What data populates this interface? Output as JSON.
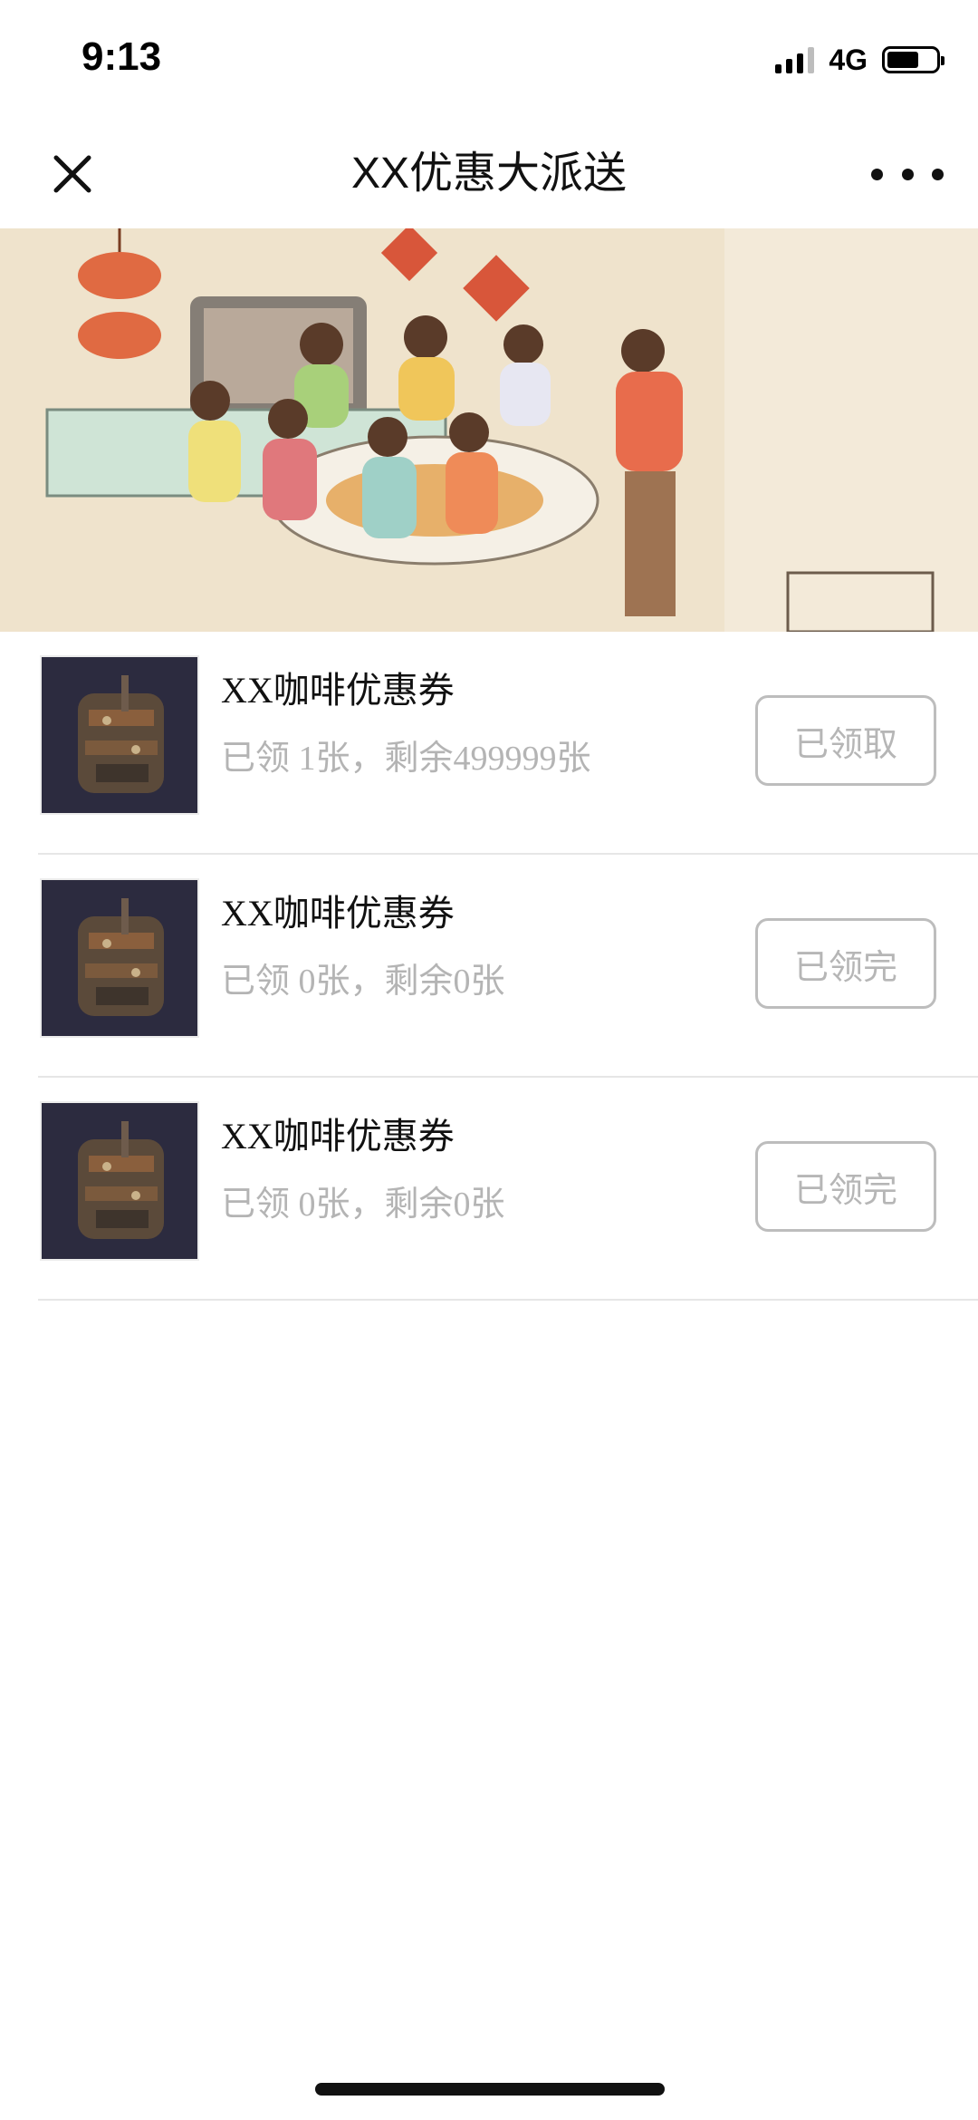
{
  "status_bar": {
    "time": "9:13",
    "network": "4G"
  },
  "nav": {
    "title": "XX优惠大派送",
    "close_icon": "close-icon",
    "more_icon": "more-icon"
  },
  "banner": {
    "scene": "family-dinner-illustration"
  },
  "coupons": [
    {
      "title": "XX咖啡优惠券",
      "subtitle": "已领 1张，剩余499999张",
      "button": "已领取"
    },
    {
      "title": "XX咖啡优惠券",
      "subtitle": "已领 0张，剩余0张",
      "button": "已领完"
    },
    {
      "title": "XX咖啡优惠券",
      "subtitle": "已领 0张，剩余0张",
      "button": "已领完"
    }
  ]
}
